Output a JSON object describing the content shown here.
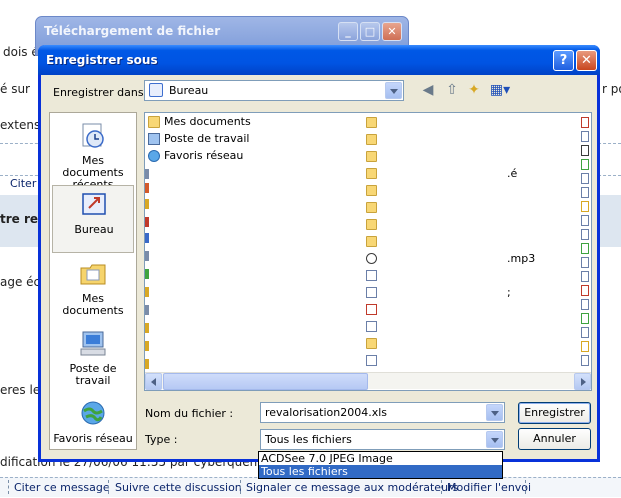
{
  "background_page": {
    "fragments": [
      {
        "text": "dois é"
      },
      {
        "text": "é sur"
      },
      {
        "text": "r po"
      },
      {
        "text": "extens"
      },
      {
        "text": "Citer"
      },
      {
        "text": "tre re"
      },
      {
        "text": "age écr"
      },
      {
        "text": "eres le"
      },
      {
        "text": "dification le 27/06/06 11:55 par cyberquent"
      }
    ],
    "bottom_links": [
      "Citer ce message",
      "Suivre cette discussion",
      "Signaler ce message aux modérateurs",
      "Modifier l'envoi"
    ]
  },
  "back_window": {
    "title": "Téléchargement de fichier"
  },
  "dialog": {
    "title": "Enregistrer sous",
    "help_glyph": "?",
    "close_glyph": "✕",
    "save_in_label": "Enregistrer dans :",
    "save_in_value": "Bureau",
    "places": [
      {
        "label": "Mes documents récents",
        "icon": "recent-documents-icon"
      },
      {
        "label": "Bureau",
        "icon": "desktop-icon",
        "selected": true
      },
      {
        "label": "Mes documents",
        "icon": "my-documents-icon"
      },
      {
        "label": "Poste de travail",
        "icon": "my-computer-icon"
      },
      {
        "label": "Favoris réseau",
        "icon": "network-places-icon"
      }
    ],
    "files_col1": [
      {
        "name": "Mes documents",
        "icon": "my-documents-icon"
      },
      {
        "name": "Poste de travail",
        "icon": "my-computer-icon"
      },
      {
        "name": "Favoris réseau",
        "icon": "network-places-icon"
      }
    ],
    "col3_fragments": [
      ".é",
      ".mp3",
      ";"
    ],
    "filename_label": "Nom du fichier :",
    "filename_value": "revalorisation2004.xls",
    "type_label": "Type :",
    "type_value": "Tous les fichiers",
    "save_button": "Enregistrer",
    "cancel_button": "Annuler",
    "type_options": [
      "ACDSee 7.0 JPEG Image",
      "Tous les fichiers"
    ],
    "type_selected_index": 1
  },
  "colors": {
    "titlebar": "#0054e3",
    "dialog_face": "#ece9d8",
    "selection": "#316ac5"
  }
}
